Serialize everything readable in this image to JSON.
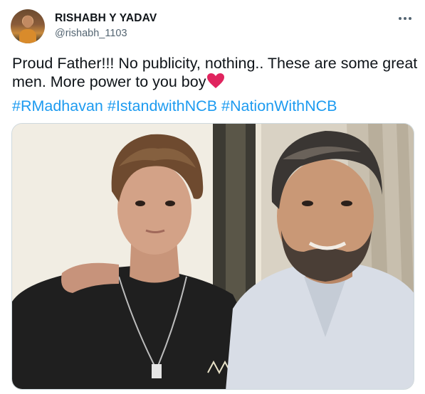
{
  "tweet": {
    "author_name": "RISHABH Y YADAV",
    "author_handle": "@rishabh_1103",
    "text_line": "Proud Father!!! No publicity, nothing.. These are some great men. More power to you boy",
    "emoji_icon": "red-heart-icon",
    "hashtags": [
      "#RMadhavan",
      "#IstandwithNCB",
      "#NationWithNCB"
    ],
    "media_alt_icon": "photo-father-son"
  },
  "colors": {
    "text": "#0f1419",
    "secondary": "#536471",
    "link": "#1d9bf0",
    "heart": "#e0245e"
  },
  "icons": {
    "more": "more-horizontal-icon"
  }
}
